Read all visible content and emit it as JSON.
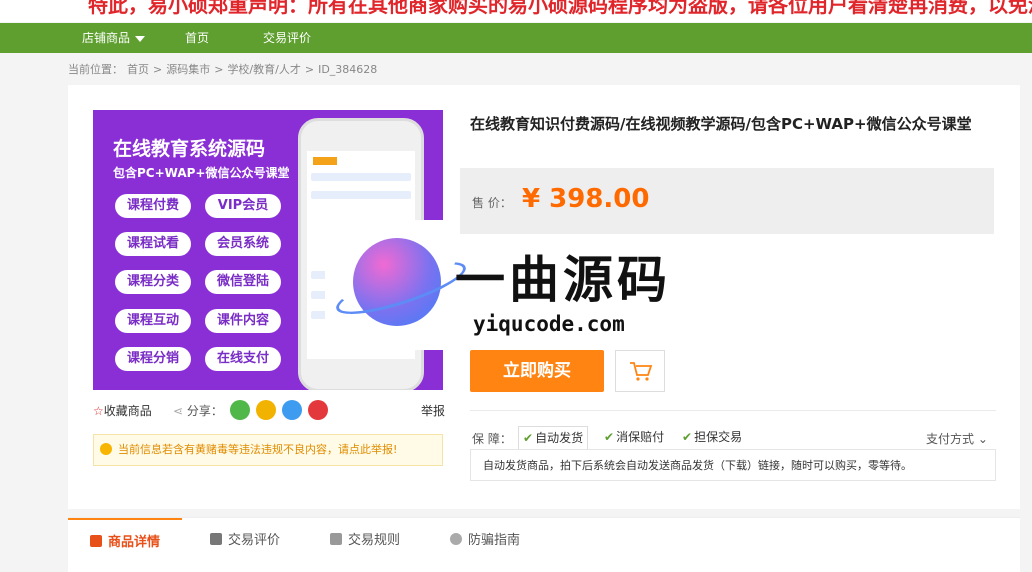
{
  "notice": "特此，易小硕郑重声明：所有在其他商家购买的易小硕源码程序均为盗版，请各位用户看清楚再消费，以免浪费",
  "nav": {
    "items": [
      "店铺商品",
      "首页",
      "交易评价"
    ]
  },
  "breadcrumb": {
    "prefix": "当前位置：",
    "items": [
      "首页",
      "源码集市",
      "学校/教育/人才",
      "ID_384628"
    ],
    "sep": ">"
  },
  "promo": {
    "title": "在线教育系统源码",
    "subtitle": "包含PC+WAP+微信公众号课堂",
    "features": [
      "课程付费",
      "VIP会员",
      "课程试看",
      "会员系统",
      "课程分类",
      "微信登陆",
      "课程互动",
      "课件内容",
      "课程分销",
      "在线支付"
    ]
  },
  "watermark": {
    "cn": "一曲源码",
    "en": "yiqucode.com"
  },
  "product": {
    "title": "在线教育知识付费源码/在线视频教学源码/包含PC+WAP+微信公众号课堂",
    "price_label": "售  价：",
    "price": "¥ 398.00",
    "buy_label": "立即购买"
  },
  "actions": {
    "favorite": "收藏商品",
    "share": "分享：",
    "report": "举报"
  },
  "warning": "当前信息若含有黄赌毒等违法违规不良内容，请点此举报!",
  "guarantee": {
    "label": "保  障：",
    "items": [
      "自动发货",
      "消保赔付",
      "担保交易"
    ],
    "pay_method": "支付方式",
    "auto_desc": "自动发货商品，拍下后系统会自动发送商品发货（下载）链接，随时可以购买，零等待。"
  },
  "tabs": [
    "商品详情",
    "交易评价",
    "交易规则",
    "防骗指南"
  ],
  "colors": {
    "nav_green": "#5e9f2f",
    "accent_orange": "#ff8411",
    "price_orange": "#ff6a00",
    "promo_purple": "#8a2ed6"
  }
}
